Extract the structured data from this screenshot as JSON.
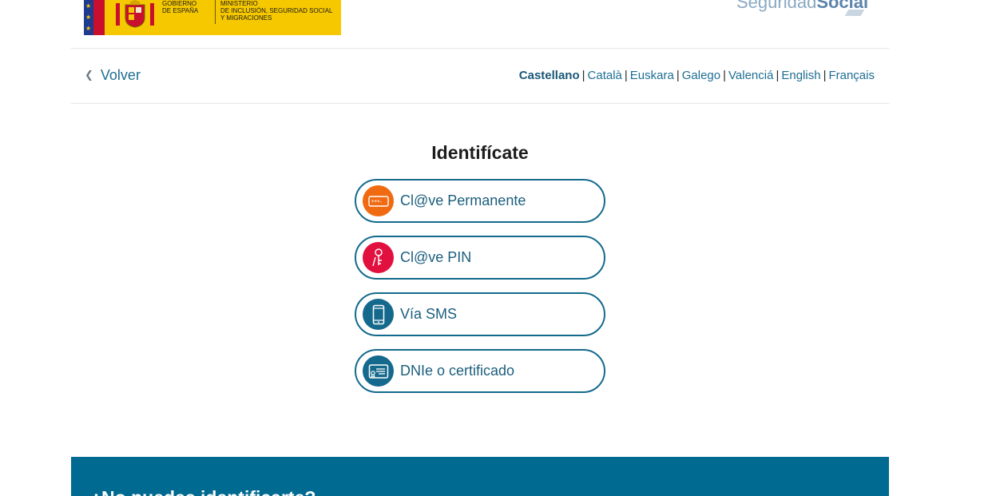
{
  "header": {
    "gov_line": "GOBIERNO\nDE ESPAÑA",
    "ministry_line": "MINISTERIO\nDE INCLUSIÓN, SEGURIDAD SOCIAL\nY MIGRACIONES",
    "logo_light": "Seguridad",
    "logo_bold": "Social"
  },
  "nav": {
    "back_label": "Volver",
    "languages": [
      {
        "label": "Castellano",
        "active": true
      },
      {
        "label": "Català"
      },
      {
        "label": "Euskara"
      },
      {
        "label": "Galego"
      },
      {
        "label": "Valenciá"
      },
      {
        "label": "English"
      },
      {
        "label": "Français"
      }
    ]
  },
  "main": {
    "title": "Identifícate",
    "options": [
      {
        "label": "Cl@ve Permanente",
        "icon": "password-icon",
        "color": "#f06a12"
      },
      {
        "label": "Cl@ve PIN",
        "icon": "key-icon",
        "color": "#e2103f"
      },
      {
        "label": "Vía SMS",
        "icon": "mobile-phone-icon",
        "color": "#15698c"
      },
      {
        "label": "DNIe o certificado",
        "icon": "id-card-icon",
        "color": "#15698c"
      }
    ]
  },
  "footer": {
    "help_title": "¿No puedes identificarte?"
  },
  "colors": {
    "primary": "#146a8c",
    "band": "#006a91",
    "banner_yellow": "#f6c800"
  }
}
